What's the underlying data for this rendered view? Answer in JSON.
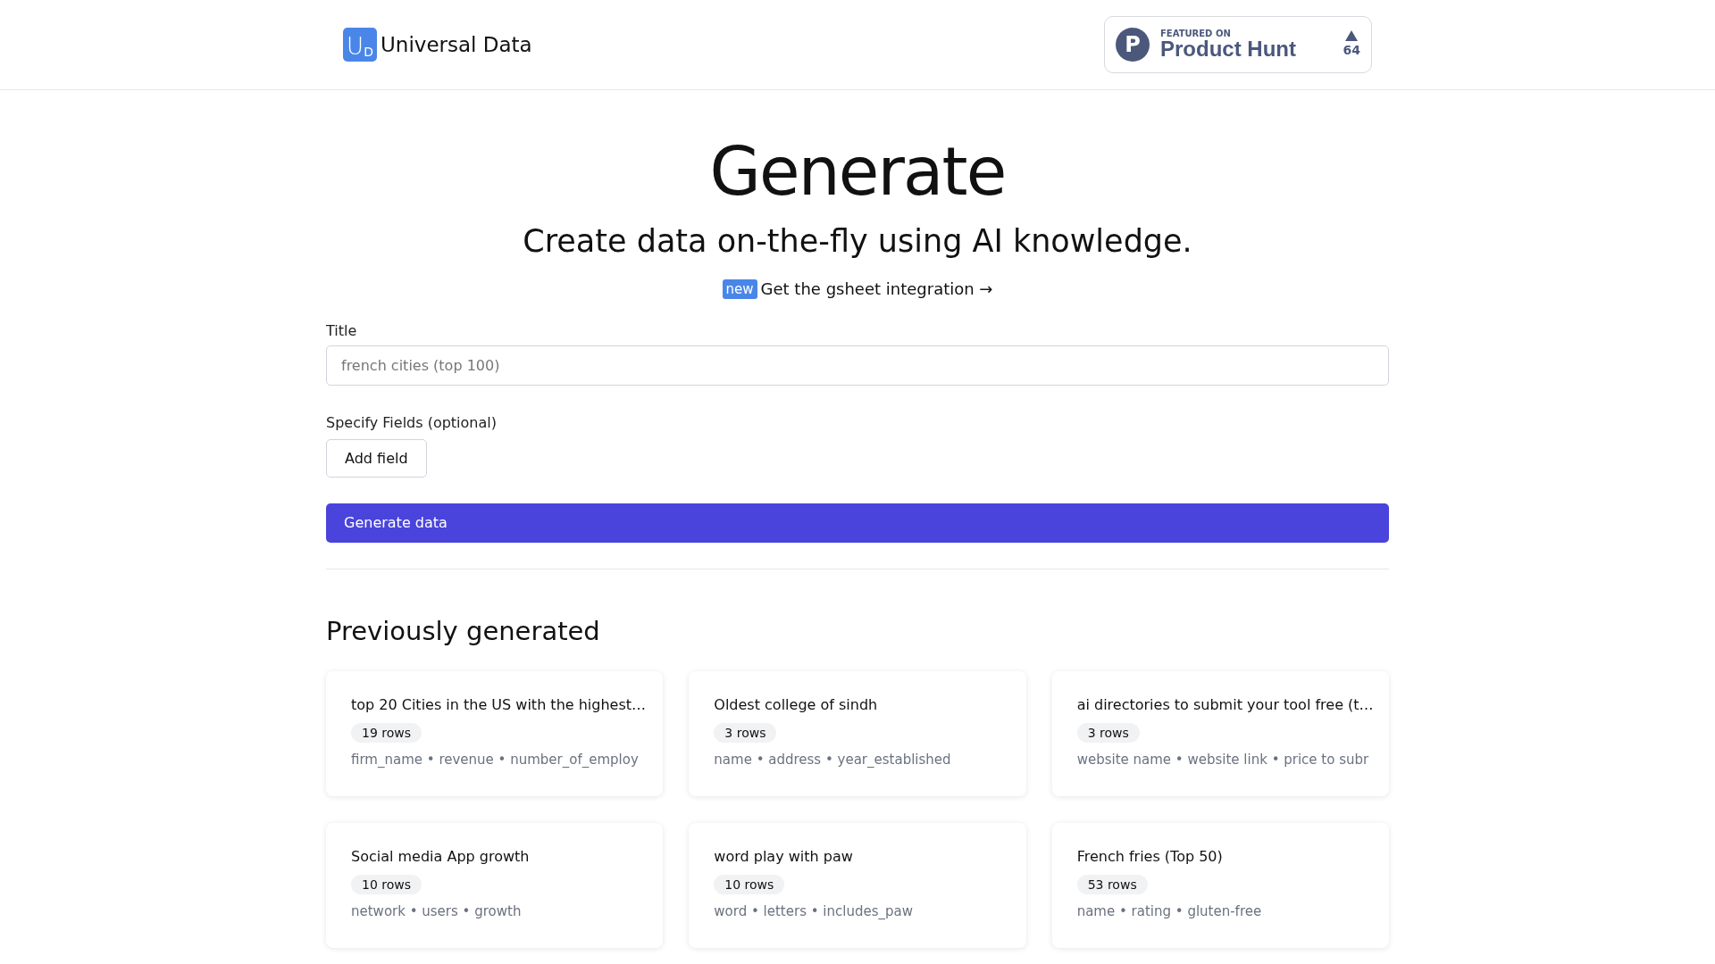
{
  "header": {
    "logo_mark": {
      "large": "U",
      "small": "D"
    },
    "brand": "Universal Data",
    "badge": {
      "letter": "P",
      "kicker": "FEATURED ON",
      "name": "Product Hunt",
      "votes": "64"
    }
  },
  "hero": {
    "title": "Generate",
    "subtitle": "Create data on-the-fly using AI knowledge.",
    "tag": "new",
    "link": "Get the gsheet integration →"
  },
  "form": {
    "title_label": "Title",
    "title_placeholder": "french cities (top 100)",
    "fields_label": "Specify Fields (optional)",
    "add_button": "Add field",
    "submit": "Generate data"
  },
  "previous": {
    "heading": "Previously generated",
    "cards": [
      {
        "title": "top 20 Cities in the US with the highest…",
        "rows": "19 rows",
        "fields": "firm_name • revenue • number_of_employ"
      },
      {
        "title": "Oldest college of sindh",
        "rows": "3 rows",
        "fields": "name • address • year_established"
      },
      {
        "title": "ai directories to submit your tool free (t…",
        "rows": "3 rows",
        "fields": "website name • website link • price to subr"
      },
      {
        "title": "Social media App growth",
        "rows": "10 rows",
        "fields": "network • users • growth"
      },
      {
        "title": "word play with paw",
        "rows": "10 rows",
        "fields": "word • letters • includes_paw"
      },
      {
        "title": "French fries (Top 50)",
        "rows": "53 rows",
        "fields": "name • rating • gluten-free"
      }
    ]
  }
}
